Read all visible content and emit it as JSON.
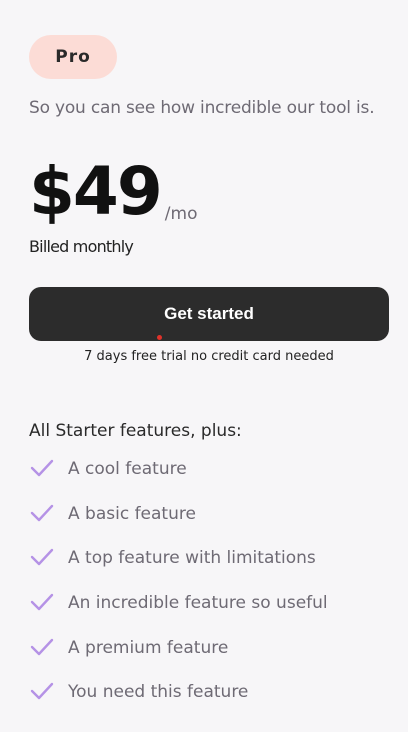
{
  "plan": {
    "badge": "Pro",
    "subtitle": "So you can see how incredible our tool is.",
    "price": "$49",
    "period": "/mo",
    "billing": "Billed monthly",
    "cta_label": "Get started",
    "trial_note": "7 days free trial no credit card needed"
  },
  "features": {
    "title": "All Starter features, plus:",
    "icon": "check-icon",
    "check_color": "#b592e6",
    "items": [
      "A cool feature",
      "A basic feature",
      "A top feature with limitations",
      "An incredible feature so useful",
      "A premium feature",
      "You need this feature"
    ]
  },
  "colors": {
    "badge_bg": "#fcdcd6",
    "button_bg": "#2c2c2c",
    "background": "#f7f6f8"
  }
}
